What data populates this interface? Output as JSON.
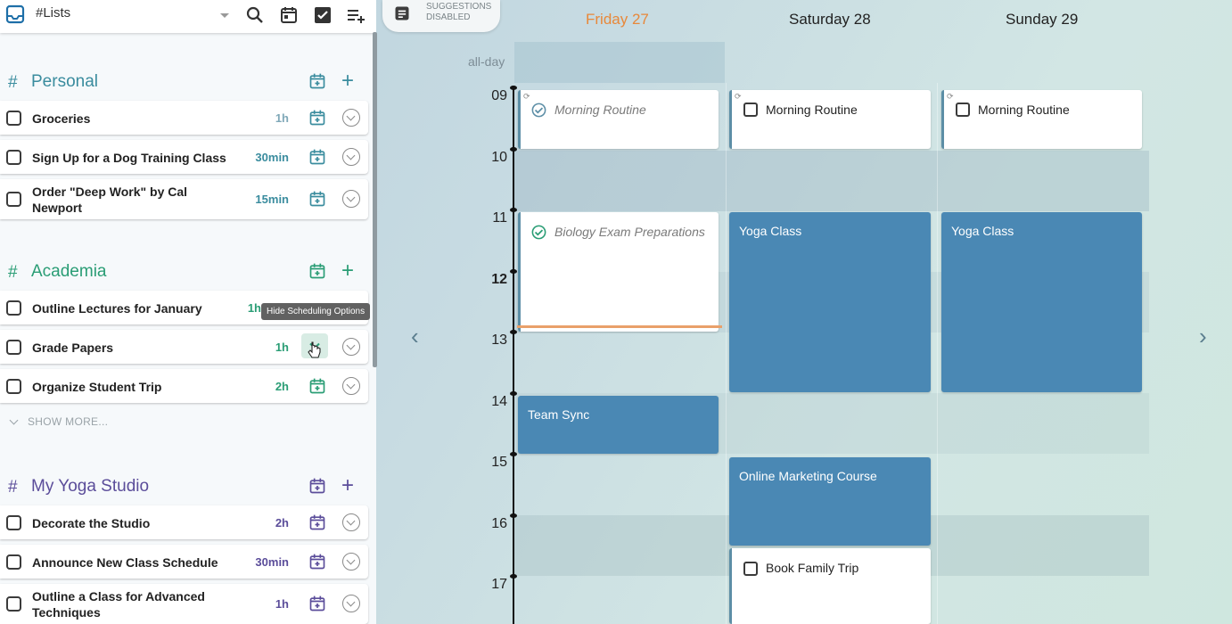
{
  "topbar": {
    "list_label": "#Lists"
  },
  "colors": {
    "personal": "#3a8c9e",
    "academia": "#2a9d75",
    "yoga": "#5b4d9a",
    "event_blue": "#4a88b4",
    "today": "#e8883a"
  },
  "sections": [
    {
      "name": "Personal",
      "hash": "#",
      "tasks": [
        {
          "title": "Groceries",
          "duration": "1h"
        },
        {
          "title": "Sign Up for a Dog Training Class",
          "duration": "30min"
        },
        {
          "title": "Order \"Deep Work\" by Cal Newport",
          "duration": "15min"
        }
      ]
    },
    {
      "name": "Academia",
      "hash": "#",
      "tasks": [
        {
          "title": "Outline Lectures for January",
          "duration": "1h"
        },
        {
          "title": "Grade Papers",
          "duration": "1h"
        },
        {
          "title": "Organize Student Trip",
          "duration": "2h"
        }
      ],
      "show_more": "SHOW MORE..."
    },
    {
      "name": "My Yoga Studio",
      "hash": "#",
      "tasks": [
        {
          "title": "Decorate the Studio",
          "duration": "2h"
        },
        {
          "title": "Announce New Class Schedule",
          "duration": "30min"
        },
        {
          "title": "Outline a Class for Advanced Techniques",
          "duration": "1h"
        }
      ]
    }
  ],
  "tooltip": "Hide Scheduling Options",
  "suggestions": {
    "line1": "SUGGESTIONS",
    "line2": "DISABLED"
  },
  "calendar": {
    "days": [
      "Friday 27",
      "Saturday 28",
      "Sunday 29"
    ],
    "allday_label": "all-day",
    "hours": [
      "09",
      "10",
      "11",
      "12",
      "13",
      "14",
      "15",
      "16",
      "17"
    ],
    "events": {
      "fri_morning": "Morning Routine",
      "fri_bio": "Biology Exam Preparations",
      "fri_sync": "Team Sync",
      "sat_morning": "Morning Routine",
      "sat_yoga": "Yoga Class",
      "sat_marketing": "Online Marketing Course",
      "sat_trip": "Book Family Trip",
      "sun_morning": "Morning Routine",
      "sun_yoga": "Yoga Class"
    },
    "nav_prev": "‹",
    "nav_next": "›"
  }
}
